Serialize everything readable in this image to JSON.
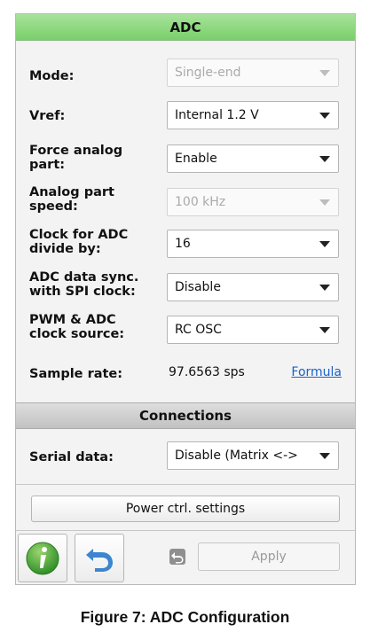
{
  "header": {
    "title": "ADC"
  },
  "rows": {
    "mode": {
      "label": "Mode:",
      "value": "Single-end",
      "disabled": true
    },
    "vref": {
      "label": "Vref:",
      "value": "Internal 1.2 V"
    },
    "force": {
      "label_line1": "Force analog",
      "label_line2": "part:",
      "value": "Enable"
    },
    "speed": {
      "label_line1": "Analog part",
      "label_line2": "speed:",
      "value": "100 kHz",
      "disabled": true
    },
    "clock_div": {
      "label_line1": "Clock for ADC",
      "label_line2": "divide by:",
      "value": "16"
    },
    "sync": {
      "label_line1": "ADC data sync.",
      "label_line2": "with SPI clock:",
      "value": "Disable"
    },
    "pwm": {
      "label_line1": "PWM & ADC",
      "label_line2": "clock source:",
      "value": "RC OSC"
    },
    "sample_rate": {
      "label": "Sample rate:",
      "value": "97.6563 sps",
      "link": "Formula"
    }
  },
  "connections": {
    "title": "Connections",
    "serial_label": "Serial data:",
    "serial_value": "Disable (Matrix <->"
  },
  "power_button": "Power ctrl. settings",
  "toolbar": {
    "apply_label": "Apply",
    "info_icon": "info-icon",
    "undo_icon": "undo-icon"
  },
  "caption": "Figure 7: ADC Configuration",
  "colors": {
    "header_green": "#79cf6a",
    "link": "#1a62c9",
    "info_green": "#3fa535",
    "undo_blue": "#3d86cf"
  }
}
